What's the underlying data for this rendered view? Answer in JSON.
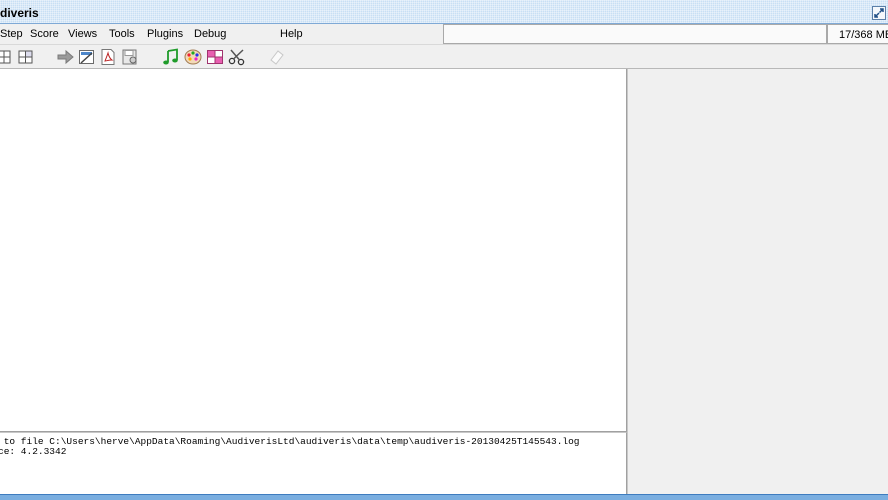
{
  "window": {
    "title": "diveris"
  },
  "menu": {
    "items": [
      "Step",
      "Score",
      "Views",
      "Tools",
      "Plugins",
      "Debug",
      "Help"
    ]
  },
  "status": {
    "memory": "17/368 MB"
  },
  "toolbar": {
    "icons": [
      "grid-icon",
      "split-grid-icon",
      "arrow-right-icon",
      "image-edit-icon",
      "pdf-icon",
      "save-disk-icon",
      "music-note-icon",
      "palette-icon",
      "table-pink-icon",
      "scissors-icon",
      "eraser-icon"
    ]
  },
  "log": {
    "lines": [
      " to file C:\\Users\\herve\\AppData\\Roaming\\AudiverisLtd\\audiveris\\data\\temp\\audiveris-20130425T145543.log",
      "ce: 4.2.3342"
    ]
  },
  "colors": {
    "titlebar": "#c8dff4",
    "bottom_bar": "#7aaee0",
    "panel_bg": "#f0f0f0"
  }
}
